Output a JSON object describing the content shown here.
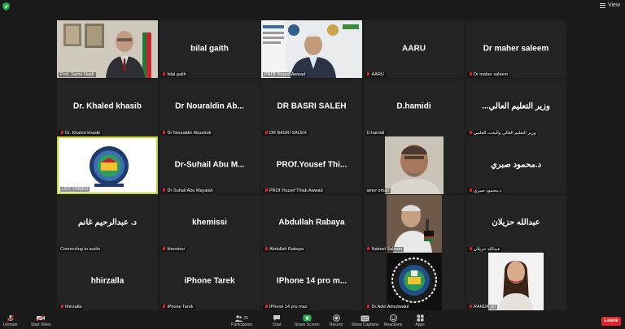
{
  "topbar": {
    "view_label": "View"
  },
  "tiles": [
    {
      "name": "",
      "label": "Prof. Samir Najdi"
    },
    {
      "name": "bilal gaith",
      "label": "bilal gaith"
    },
    {
      "name": "",
      "label": "PROf.Yousef Awwad"
    },
    {
      "name": "AARU",
      "label": "AARU"
    },
    {
      "name": "Dr maher saleem",
      "label": "Dr maher saleem"
    },
    {
      "name": "Dr. Khaled khasib",
      "label": "Dr. Khaled khasib"
    },
    {
      "name": "Dr Nouraldin Ab...",
      "label": "Dr Nouraldin Abualrob"
    },
    {
      "name": "DR BASRI SALEH",
      "label": "DR BASRI SALEH"
    },
    {
      "name": "D.hamidi",
      "label": "D.hamidi"
    },
    {
      "name": "وزير التعليم العالي...",
      "label": "وزير التعليم العالي والبحث العلمي"
    },
    {
      "name": "",
      "label": "UST-YEMEN"
    },
    {
      "name": "Dr-Suhail Abu M...",
      "label": "Dr-Suhail Abu Mayalah"
    },
    {
      "name": "PROf.Yousef Thi...",
      "label": "PROf.Yousef Thiab Awwad"
    },
    {
      "name": "",
      "label": "amer omari"
    },
    {
      "name": "د.محمود صبري",
      "label": "د.محمود صبري"
    },
    {
      "name": "د. عبدالرحيم غانم",
      "label": "Connecting to audio"
    },
    {
      "name": "khemissi",
      "label": "khemissi"
    },
    {
      "name": "Abdullah Rabaya",
      "label": "Abdullah Rabaya"
    },
    {
      "name": "",
      "label": "Nabeel Saleem"
    },
    {
      "name": "عبدالله حزيلان",
      "label": "عبدالله حزيلان"
    },
    {
      "name": "hhirzalla",
      "label": "hhirzalla"
    },
    {
      "name": "iPhone Tarek",
      "label": "iPhone Tarek"
    },
    {
      "name": "IPhone 14 pro m...",
      "label": "IPhone 14 pro max"
    },
    {
      "name": "",
      "label": "Dr.Adel Almutwakil"
    },
    {
      "name": "",
      "label": "RANDA jizi"
    }
  ],
  "toolbar": {
    "unmute": "Unmute",
    "start_video": "Start Video",
    "participants": "Participants",
    "participants_count": "25",
    "chat": "Chat",
    "share_screen": "Share Screen",
    "record": "Record",
    "captions": "Show Captions",
    "reactions": "Reactions",
    "apps": "Apps",
    "leave": "Leave"
  },
  "colors": {
    "active_border": "#c6d62a",
    "share_green": "#22b14c",
    "leave_red": "#e0262a",
    "muted_red": "#e02828"
  }
}
